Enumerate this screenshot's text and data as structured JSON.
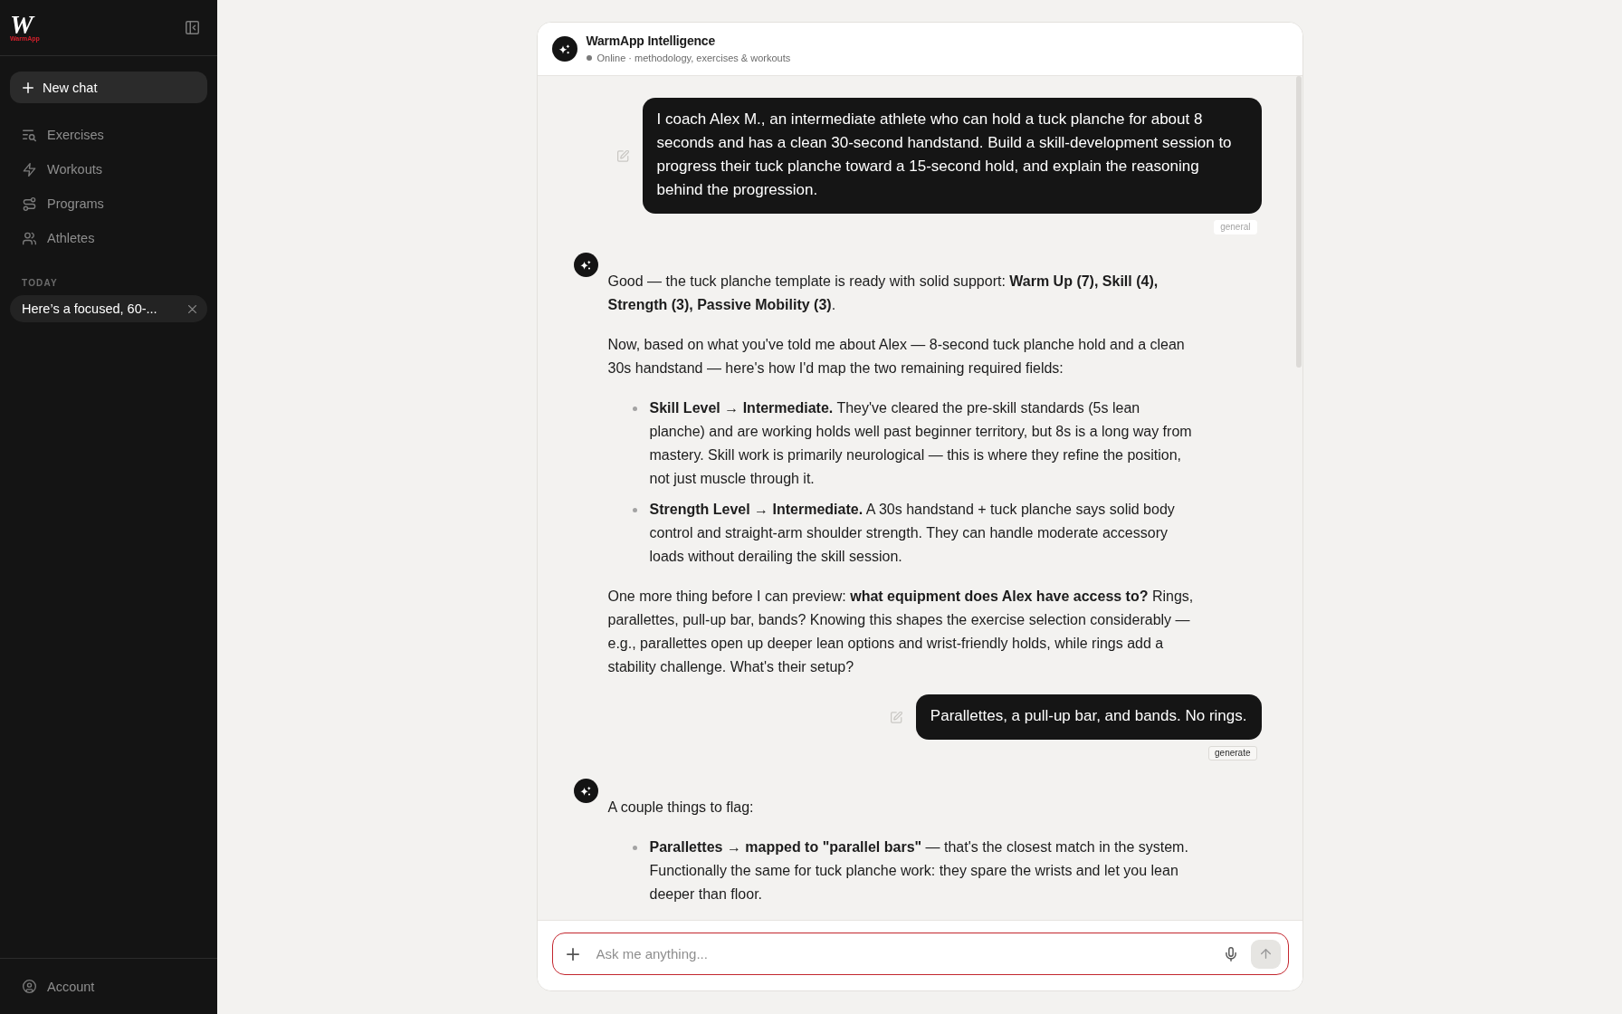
{
  "sidebar": {
    "logo": {
      "mark": "W",
      "wordmark": "WarmApp"
    },
    "new_chat": "New chat",
    "nav": [
      {
        "label": "Exercises",
        "selected": false
      },
      {
        "label": "Workouts",
        "selected": false
      },
      {
        "label": "Programs",
        "selected": false
      },
      {
        "label": "Athletes",
        "selected": false
      }
    ],
    "history_heading": "TODAY",
    "history": [
      {
        "title": "Here’s a focused, 60-...",
        "selected": true
      }
    ],
    "account": "Account"
  },
  "chat": {
    "title": "WarmApp Intelligence",
    "status": "Online · methodology, exercises & workouts",
    "messages": [
      {
        "kind": "user",
        "text": "I coach Alex M., an intermediate athlete who can hold a tuck planche for about 8 seconds and has a clean 30-second handstand. Build a skill-development session to progress their tuck planche toward a 15-second hold, and explain the reasoning behind the progression.",
        "tag": {
          "label": "general",
          "muted": true
        }
      },
      {
        "kind": "assistant",
        "blocks": [
          {
            "kind": "paragraph",
            "text": "Good — the tuck planche template is ready with solid support: **Warm Up (7), Skill (4), Strength (3), Passive Mobility (3)**."
          },
          {
            "kind": "paragraph",
            "text": "Now, based on what you've told me about Alex — 8-second tuck planche hold and a clean 30s handstand — here's how I'd map the two remaining required fields:"
          },
          {
            "kind": "list",
            "items": [
              "**Skill Level → Intermediate.** They've cleared the pre-skill standards (5s lean planche) and are working holds well past beginner territory, but 8s is a long way from mastery. Skill work is primarily neurological — this is where they refine the position, not just muscle through it.",
              "**Strength Level → Intermediate.** A 30s handstand + tuck planche says solid body control and straight-arm shoulder strength. They can handle moderate accessory loads without derailing the skill session."
            ]
          },
          {
            "kind": "paragraph",
            "text": "One more thing before I can preview: **what equipment does Alex have access to?** Rings, parallettes, pull-up bar, bands? Knowing this shapes the exercise selection considerably — e.g., parallettes open up deeper lean options and wrist-friendly holds, while rings add a stability challenge. What's their setup?"
          }
        ]
      },
      {
        "kind": "user",
        "text": "Parallettes, a pull-up bar, and bands. No rings.",
        "tag": {
          "label": "generate",
          "muted": false
        }
      },
      {
        "kind": "assistant",
        "blocks": [
          {
            "kind": "paragraph",
            "text": "A couple things to flag:"
          },
          {
            "kind": "list",
            "items": [
              "**Parallettes → mapped to \"parallel bars\"** — that's the closest match in the system. Functionally the same for tuck planche work: they spare the wrists and let you lean deeper than floor."
            ]
          }
        ]
      }
    ],
    "input": {
      "placeholder": "Ask me anything...",
      "focused": true,
      "send_disabled": true
    }
  }
}
